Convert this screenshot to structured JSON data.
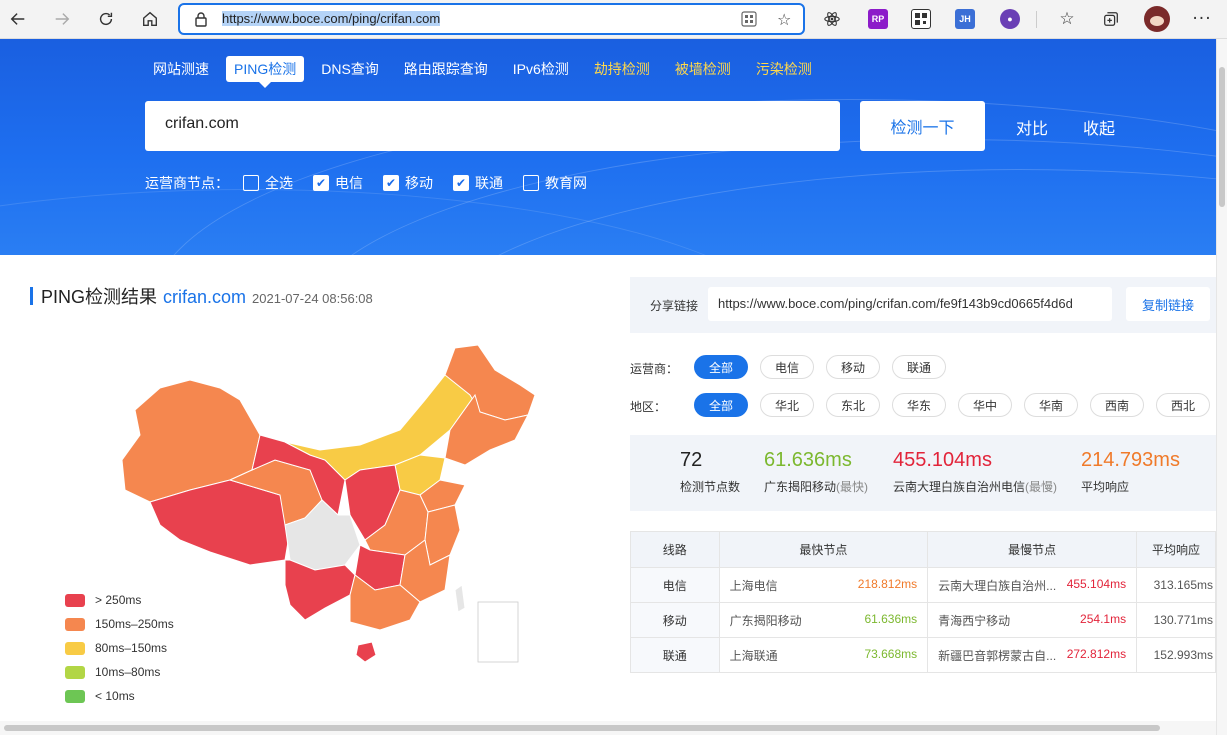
{
  "browser": {
    "url": "https://www.boce.com/ping/crifan.com",
    "extensions": [
      "react-icon",
      "RP",
      "qr-icon",
      "JH",
      "ext-icon"
    ]
  },
  "nav": {
    "items": [
      {
        "label": "网站测速",
        "style": "normal"
      },
      {
        "label": "PING检测",
        "style": "active"
      },
      {
        "label": "DNS查询",
        "style": "normal"
      },
      {
        "label": "路由跟踪查询",
        "style": "normal"
      },
      {
        "label": "IPv6检测",
        "style": "normal"
      },
      {
        "label": "劫持检测",
        "style": "yellow"
      },
      {
        "label": "被墙检测",
        "style": "yellow"
      },
      {
        "label": "污染检测",
        "style": "yellow"
      }
    ]
  },
  "search": {
    "value": "crifan.com",
    "button": "检测一下",
    "compare": "对比",
    "collapse": "收起"
  },
  "isp_select": {
    "label": "运营商节点：",
    "options": [
      {
        "label": "全选",
        "checked": false
      },
      {
        "label": "电信",
        "checked": true
      },
      {
        "label": "移动",
        "checked": true
      },
      {
        "label": "联通",
        "checked": true
      },
      {
        "label": "教育网",
        "checked": false
      }
    ]
  },
  "result": {
    "title": "PING检测结果",
    "domain": "crifan.com",
    "time": "2021-07-24 08:56:08"
  },
  "legend": [
    {
      "label": "> 250ms",
      "color": "#e8414e"
    },
    {
      "label": "150ms–250ms",
      "color": "#f5874f"
    },
    {
      "label": "80ms–150ms",
      "color": "#f8cb45"
    },
    {
      "label": "10ms–80ms",
      "color": "#b2d645"
    },
    {
      "label": "< 10ms",
      "color": "#6dc654"
    }
  ],
  "share": {
    "label": "分享链接",
    "url": "https://www.boce.com/ping/crifan.com/fe9f143b9cd0665f4d6d",
    "copy": "复制链接"
  },
  "filters": {
    "isp_label": "运营商：",
    "isp": [
      "全部",
      "电信",
      "移动",
      "联通"
    ],
    "region_label": "地区：",
    "region": [
      "全部",
      "华北",
      "东北",
      "华东",
      "华中",
      "华南",
      "西南",
      "西北"
    ]
  },
  "stats": {
    "count": {
      "value": "72",
      "label": "检测节点数"
    },
    "fastest": {
      "value": "61.636ms",
      "label": "广东揭阳移动",
      "tag": "(最快)"
    },
    "slowest": {
      "value": "455.104ms",
      "label": "云南大理白族自治州电信",
      "tag": "(最慢)"
    },
    "average": {
      "value": "214.793ms",
      "label": "平均响应"
    }
  },
  "table": {
    "headers": [
      "线路",
      "最快节点",
      "最慢节点",
      "平均响应"
    ],
    "rows": [
      {
        "line": "电信",
        "fast_node": "上海电信",
        "fast_ms": "218.812ms",
        "slow_node": "云南大理白族自治州...",
        "slow_ms": "455.104ms",
        "avg": "313.165ms"
      },
      {
        "line": "移动",
        "fast_node": "广东揭阳移动",
        "fast_ms": "61.636ms",
        "slow_node": "青海西宁移动",
        "slow_ms": "254.1ms",
        "avg": "130.771ms"
      },
      {
        "line": "联通",
        "fast_node": "上海联通",
        "fast_ms": "73.668ms",
        "slow_node": "新疆巴音郭楞蒙古自...",
        "slow_ms": "272.812ms",
        "avg": "152.993ms"
      }
    ]
  }
}
